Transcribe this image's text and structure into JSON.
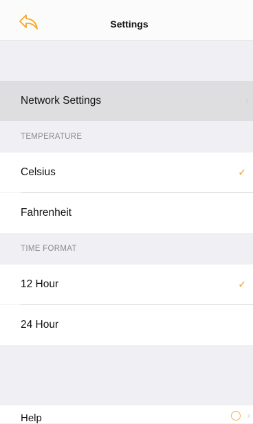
{
  "nav": {
    "title": "Settings",
    "back_icon": "back-arrow-icon",
    "accent": "#f39a1e"
  },
  "network": {
    "label": "Network Settings",
    "chevron": "›"
  },
  "temperature": {
    "header": "TEMPERATURE",
    "options": [
      {
        "label": "Celsius",
        "selected": true
      },
      {
        "label": "Fahrenheit",
        "selected": false
      }
    ]
  },
  "time_format": {
    "header": "TIME FORMAT",
    "options": [
      {
        "label": "12 Hour",
        "selected": true
      },
      {
        "label": "24 Hour",
        "selected": false
      }
    ]
  },
  "check_mark": "✓",
  "bottom": {
    "label": "Help",
    "icon": "info-icon",
    "chevron": "›"
  }
}
